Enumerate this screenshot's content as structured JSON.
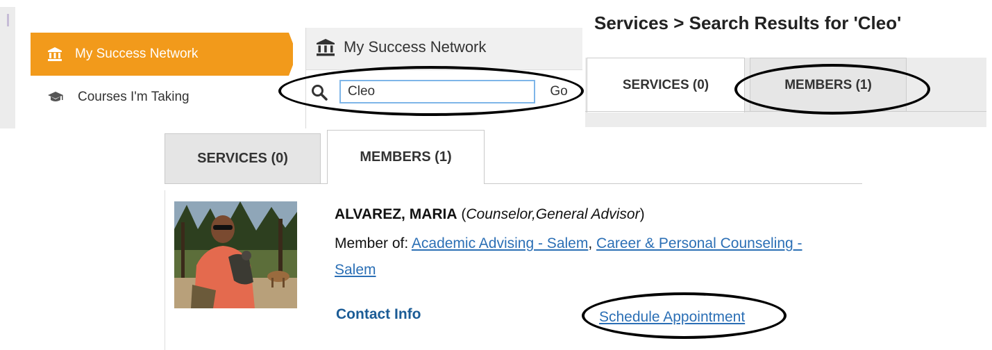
{
  "nav": {
    "items": [
      {
        "label": "My Success Network",
        "icon": "institution-icon",
        "active": true
      },
      {
        "label": "Courses I'm Taking",
        "icon": "graduation-cap-icon",
        "active": false
      }
    ],
    "active_color": "#f29a1b"
  },
  "search_panel": {
    "title": "My Success Network",
    "title_icon": "institution-icon",
    "search_value": "Cleo",
    "go_label": "Go"
  },
  "results_header": {
    "heading": "Services > Search Results for 'Cleo'",
    "tabs": [
      {
        "label": "SERVICES (0)",
        "selected": true
      },
      {
        "label": "MEMBERS (1)",
        "selected": false
      }
    ]
  },
  "results": {
    "tabs": [
      {
        "label": "SERVICES (0)",
        "selected": false
      },
      {
        "label": "MEMBERS (1)",
        "selected": true
      }
    ],
    "member": {
      "name": "ALVAREZ, MARIA",
      "role_open": "(",
      "role": "Counselor,General Advisor",
      "role_close": ")",
      "member_of_label": "Member of:",
      "groups": [
        "Academic Advising - Salem",
        "Career & Personal Counseling - Salem"
      ],
      "separator": ",",
      "contact_label": "Contact Info",
      "schedule_label": "Schedule Appointment"
    }
  },
  "colors": {
    "link": "#2b6fb5",
    "contact": "#1b5c96",
    "annotation": "#000000"
  }
}
